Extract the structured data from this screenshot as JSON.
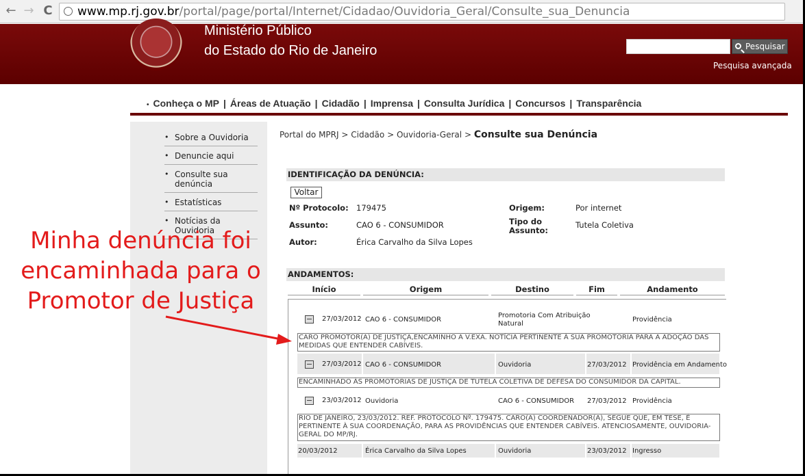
{
  "browser": {
    "back_glyph": "←",
    "forward_glyph": "→",
    "reload_glyph": "C",
    "url_domain": "www.mp.rj.gov.br",
    "url_path": "/portal/page/portal/Internet/Cidadao/Ouvidoria_Geral/Consulte_sua_Denuncia"
  },
  "header": {
    "line1": "Ministério Público",
    "line2": "do Estado do Rio de Janeiro",
    "search_value": "",
    "search_button": "Pesquisar",
    "advanced_search": "Pesquisa avançada"
  },
  "mainnav": {
    "items": [
      "Conheça o MP",
      "Áreas de Atuação",
      "Cidadão",
      "Imprensa",
      "Consulta Jurídica",
      "Concursos",
      "Transparência"
    ],
    "separator": "|"
  },
  "sidebar": {
    "items": [
      "Sobre a Ouvidoria",
      "Denuncie aqui",
      "Consulte sua denúncia",
      "Estatísticas",
      "Notícias da Ouvidoria"
    ]
  },
  "breadcrumb": {
    "items": [
      "Portal do MPRJ",
      "Cidadão",
      "Ouvidoria-Geral"
    ],
    "separator": ">",
    "current": "Consulte sua Denúncia"
  },
  "identificacao": {
    "title": "IDENTIFICAÇÃO DA DENÚNCIA:",
    "back_button": "Voltar",
    "protocolo_label": "Nº Protocolo:",
    "protocolo": "179475",
    "assunto_label": "Assunto:",
    "assunto": "CAO 6 - CONSUMIDOR",
    "autor_label": "Autor:",
    "autor": "Érica Carvalho da Silva Lopes",
    "origem_label": "Origem:",
    "origem": "Por internet",
    "tipo_label_1": "Tipo do",
    "tipo_label_2": "Assunto:",
    "tipo": "Tutela Coletiva"
  },
  "andamentos": {
    "title": "ANDAMENTOS:",
    "columns": [
      "Início",
      "Origem",
      "Destino",
      "Fim",
      "Andamento"
    ],
    "rows": [
      {
        "inicio": "27/03/2012",
        "origem": "CAO 6 - CONSUMIDOR",
        "destino_1": "Promotoria Com Atribuição",
        "destino_2": "Natural",
        "fim": "",
        "andamento": "Providência",
        "note_1": "CARO PROMOTOR(A) DE JUSTIÇA,ENCAMINHO A V.EXA. NOTÍCIA PERTINENTE À SUA PROMOTORIA PARA A ADOÇÃO DAS",
        "note_2": "MEDIDAS QUE ENTENDER CABÍVEIS."
      },
      {
        "inicio": "27/03/2012",
        "origem": "CAO 6 - CONSUMIDOR",
        "destino": "Ouvidoria",
        "fim": "27/03/2012",
        "andamento": "Providência em Andamento",
        "note_1": "ENCAMINHADO ÀS PROMOTORIAS DE JUSTIÇA DE TUTELA COLETIVA DE DEFESA DO CONSUMIDOR DA CAPITAL."
      },
      {
        "inicio": "23/03/2012",
        "origem": "Ouvidoria",
        "destino": "CAO 6 - CONSUMIDOR",
        "fim": "27/03/2012",
        "andamento": "Providência",
        "note_1": "RIO DE JANEIRO, 23/03/2012. REF. PROTOCOLO Nº. 179475. CARO(A) COORDENADOR(A), SEGUE QUE, EM TESE, É",
        "note_2": "PERTINENTE À SUA COORDENAÇÃO, PARA AS PROVIDÊNCIAS QUE ENTENDER CABÍVEIS. ATENCIOSAMENTE, OUVIDORIA-",
        "note_3": "GERAL DO MP/RJ."
      },
      {
        "inicio": "20/03/2012",
        "origem": "Érica Carvalho da Silva Lopes",
        "destino": "Ouvidoria",
        "fim": "23/03/2012",
        "andamento": "Ingresso"
      }
    ]
  },
  "annotation": {
    "line1": "Minha denúncia foi",
    "line2": "encaminhada para o",
    "line3": "Promotor de Justiça",
    "color": "#e31b1b"
  }
}
